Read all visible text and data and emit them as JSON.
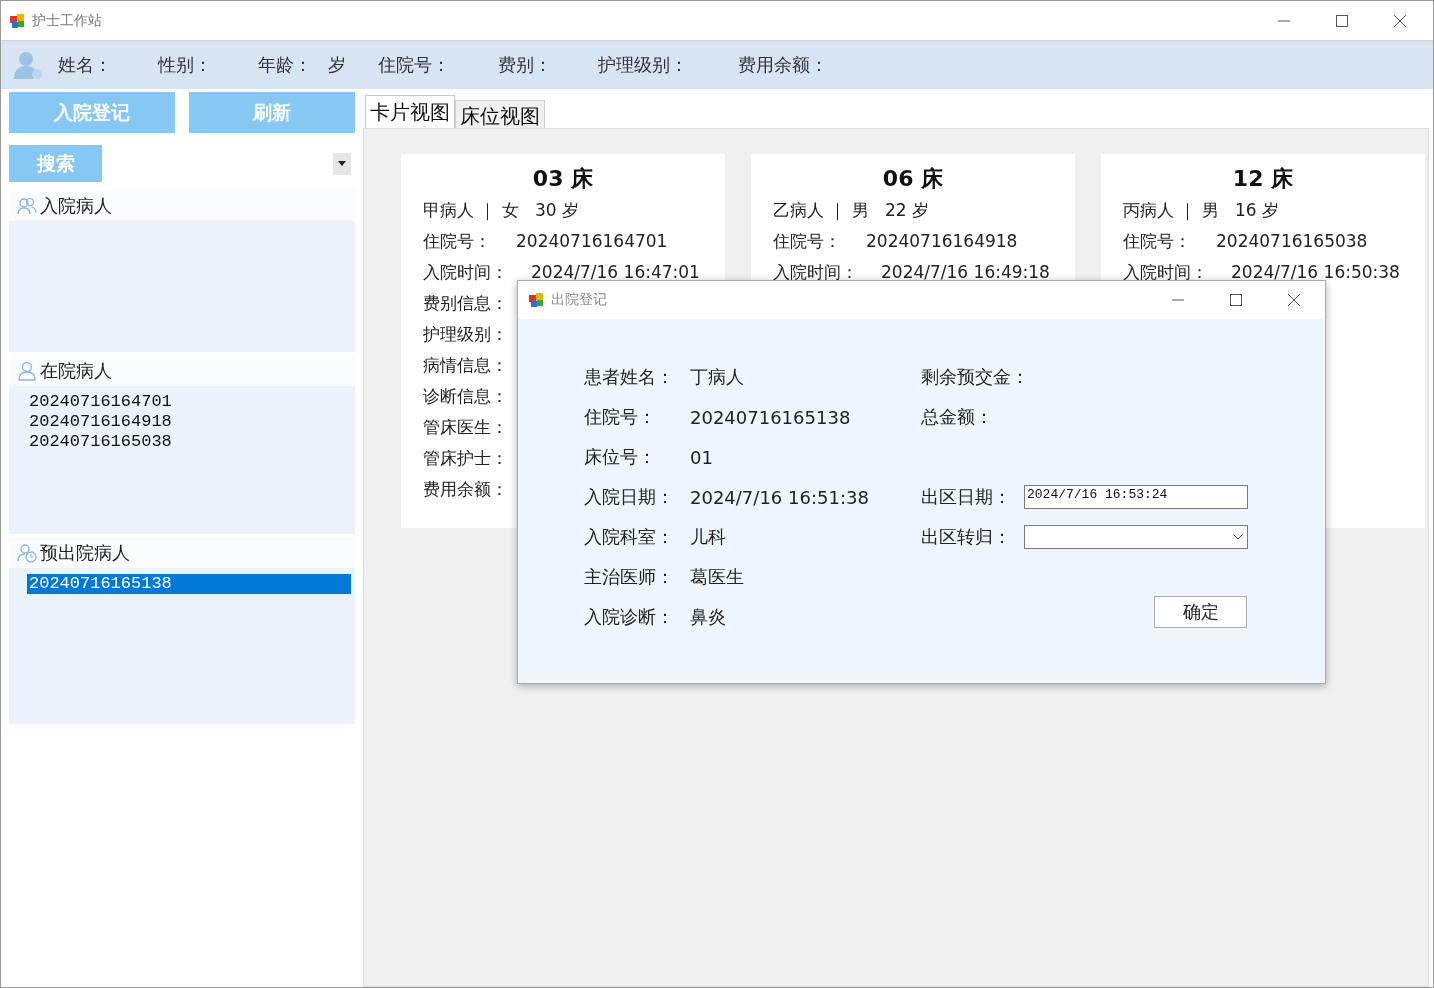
{
  "window": {
    "title": "护士工作站"
  },
  "patient_bar": {
    "fields": [
      "姓名：",
      "性别：",
      "年龄：",
      "岁",
      "住院号：",
      "费别：",
      "护理级别：",
      "费用余额："
    ]
  },
  "actions": [
    "入院登记",
    "刷新"
  ],
  "search": {
    "button": "搜索"
  },
  "sections": [
    {
      "title": "入院病人"
    },
    {
      "title": "在院病人",
      "items": [
        {
          "text": "20240716164701",
          "selected": false
        },
        {
          "text": "20240716164918",
          "selected": false
        },
        {
          "text": "20240716165038",
          "selected": false
        }
      ]
    },
    {
      "title": "预出院病人",
      "items": [
        {
          "text": "20240716165138",
          "selected": true
        }
      ]
    }
  ],
  "tabs": [
    {
      "label": "卡片视图",
      "selected": true
    },
    {
      "label": "床位视图",
      "selected": false
    }
  ],
  "cards": [
    {
      "bed": "03 床",
      "summary": "甲病人 ｜ 女   30 岁",
      "lines": [
        {
          "label": "住院号：",
          "value": "20240716164701"
        },
        {
          "label": "入院时间：",
          "value": "2024/7/16 16:47:01"
        },
        {
          "label": "费别信息："
        },
        {
          "label": "护理级别："
        },
        {
          "label": "病情信息："
        },
        {
          "label": "诊断信息："
        },
        {
          "label": "管床医生："
        },
        {
          "label": "管床护士："
        },
        {
          "label": "费用余额："
        }
      ]
    },
    {
      "bed": "06 床",
      "summary": "乙病人 ｜ 男   22 岁",
      "lines": [
        {
          "label": "住院号：",
          "value": "20240716164918"
        },
        {
          "label": "入院时间：",
          "value": "2024/7/16 16:49:18"
        }
      ]
    },
    {
      "bed": "12 床",
      "summary": "丙病人 ｜ 男   16 岁",
      "lines": [
        {
          "label": "住院号：",
          "value": "20240716165038"
        },
        {
          "label": "入院时间：",
          "value": "2024/7/16 16:50:38"
        }
      ]
    }
  ],
  "dialog": {
    "title": "出院登记",
    "left_fields": [
      {
        "label": "患者姓名：",
        "value": "丁病人"
      },
      {
        "label": "住院号：",
        "value": "20240716165138"
      },
      {
        "label": "床位号：",
        "value": "01"
      },
      {
        "label": "入院日期：",
        "value": "2024/7/16 16:51:38"
      },
      {
        "label": "入院科室：",
        "value": "儿科"
      },
      {
        "label": "主治医师：",
        "value": "葛医生"
      },
      {
        "label": "入院诊断：",
        "value": "鼻炎"
      }
    ],
    "right_fields": [
      {
        "label": "剩余预交金：",
        "kind": "text"
      },
      {
        "label": "总金额：",
        "kind": "text"
      },
      {
        "label": "出区日期：",
        "kind": "datetime",
        "value": "2024/7/16 16:53:24"
      },
      {
        "label": "出区转归：",
        "kind": "dropdown"
      }
    ],
    "button": "确定"
  }
}
